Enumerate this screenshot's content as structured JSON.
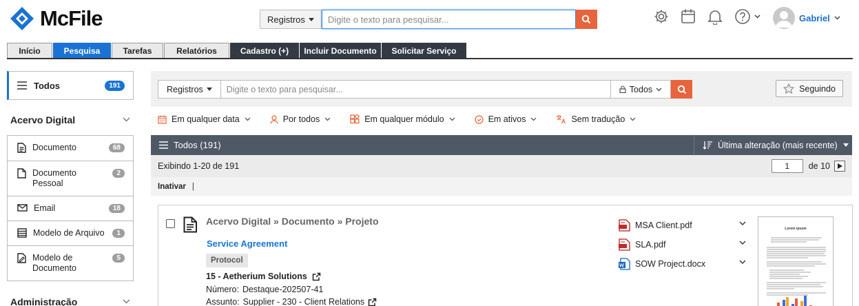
{
  "brand": {
    "name": "McFile",
    "color": "#1a73d4"
  },
  "header": {
    "scope_label": "Registros",
    "search_placeholder": "Digite o texto para pesquisar...",
    "user_name": "Gabriel",
    "icons": [
      "gear-icon",
      "calendar-icon",
      "bell-icon",
      "help-icon"
    ]
  },
  "tabs": [
    {
      "label": "Início",
      "style": "light"
    },
    {
      "label": "Pesquisa",
      "style": "active"
    },
    {
      "label": "Tarefas",
      "style": "light"
    },
    {
      "label": "Relatórios",
      "style": "light"
    },
    {
      "label": "Cadastro (+)",
      "style": "dark"
    },
    {
      "label": "Incluir Documento",
      "style": "dark"
    },
    {
      "label": "Solicitar Serviço",
      "style": "dark"
    }
  ],
  "sidebar": {
    "todos": {
      "label": "Todos",
      "count": "191"
    },
    "section1": "Acervo Digital",
    "items": [
      {
        "label": "Documento",
        "count": "68",
        "icon": "document-icon"
      },
      {
        "label": "Documento Pessoal",
        "count": "2",
        "icon": "page-icon"
      },
      {
        "label": "Email",
        "count": "18",
        "icon": "envelope-icon"
      },
      {
        "label": "Modelo de Arquivo",
        "count": "1",
        "icon": "table-icon"
      },
      {
        "label": "Modelo de Documento",
        "count": "5",
        "icon": "template-icon"
      }
    ],
    "section2": "Administração"
  },
  "main": {
    "scope_label": "Registros",
    "search_placeholder": "Digite o texto para pesquisar...",
    "filter_scope": "Todos",
    "follow_label": "Seguindo",
    "filters": [
      {
        "label": "Em qualquer data",
        "icon": "calendar-icon"
      },
      {
        "label": "Por todos",
        "icon": "person-icon"
      },
      {
        "label": "Em qualquer módulo",
        "icon": "modules-icon"
      },
      {
        "label": "Em ativos",
        "icon": "check-circle-icon"
      },
      {
        "label": "Sem tradução",
        "icon": "translate-icon"
      }
    ],
    "list_title": "Todos (191)",
    "sort_label": "Última alteração (mais recente)",
    "range_text": "Exibindo 1-20 de 191",
    "page": "1",
    "page_of": "de 10",
    "action_inativar": "Inativar",
    "action_sep": "|"
  },
  "card": {
    "breadcrumb": "Acervo Digital » Documento » Projeto",
    "title": "Service Agreement",
    "tag": "Protocol",
    "org": "15 - Aetherium Solutions",
    "numero_label": "Número:",
    "numero_value": "Destaque-202507-41",
    "assunto_label": "Assunto:",
    "assunto_value": "Supplier - 230 - Client Relations",
    "attachments": [
      {
        "name": "MSA Client.pdf",
        "type": "pdf"
      },
      {
        "name": "SLA.pdf",
        "type": "pdf"
      },
      {
        "name": "SOW Project.docx",
        "type": "docx"
      }
    ],
    "preview_title": "Lorem ipsum"
  },
  "colors": {
    "accent": "#1a73d4",
    "search": "#e8643c",
    "dark_tab": "#333a44",
    "list_header": "#4f5966"
  }
}
